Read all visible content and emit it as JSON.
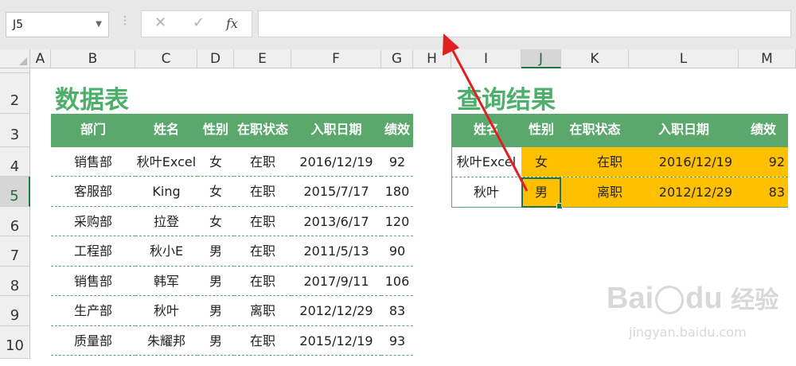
{
  "name_box": "J5",
  "formula_bar": {
    "cancel_icon": "✕",
    "enter_icon": "✓",
    "fx_label": "fx",
    "content": ""
  },
  "columns": [
    "A",
    "B",
    "C",
    "D",
    "E",
    "F",
    "G",
    "H",
    "I",
    "J",
    "K",
    "L",
    "M"
  ],
  "rows": [
    "2",
    "3",
    "4",
    "5",
    "6",
    "7",
    "8",
    "9",
    "10"
  ],
  "data_table": {
    "title": "数据表",
    "headers": [
      "部门",
      "姓名",
      "性别",
      "在职状态",
      "入职日期",
      "绩效"
    ],
    "rows": [
      [
        "销售部",
        "秋叶Excel",
        "女",
        "在职",
        "2016/12/19",
        "92"
      ],
      [
        "客服部",
        "King",
        "女",
        "在职",
        "2015/7/17",
        "180"
      ],
      [
        "采购部",
        "拉登",
        "女",
        "在职",
        "2013/6/17",
        "120"
      ],
      [
        "工程部",
        "秋小E",
        "男",
        "在职",
        "2011/5/13",
        "90"
      ],
      [
        "销售部",
        "韩军",
        "男",
        "在职",
        "2017/9/11",
        "106"
      ],
      [
        "生产部",
        "秋叶",
        "男",
        "离职",
        "2012/12/29",
        "83"
      ],
      [
        "质量部",
        "朱耀邦",
        "男",
        "在职",
        "2015/12/19",
        "93"
      ]
    ]
  },
  "result_table": {
    "title": "查询结果",
    "headers": [
      "姓名",
      "性别",
      "在职状态",
      "入职日期",
      "绩效"
    ],
    "rows": [
      [
        "秋叶Excel",
        "女",
        "在职",
        "2016/12/19",
        "92"
      ],
      [
        "秋叶",
        "男",
        "离职",
        "2012/12/29",
        "83"
      ]
    ]
  },
  "watermark": {
    "brand": "Bai",
    "brand2": "du",
    "cn": "经验",
    "url": "jingyan.baidu.com"
  },
  "colors": {
    "header_green": "#5aa86c",
    "title_green": "#4caf6a",
    "highlight": "#ffc000",
    "arrow": "#e02020",
    "selection": "#217346"
  }
}
